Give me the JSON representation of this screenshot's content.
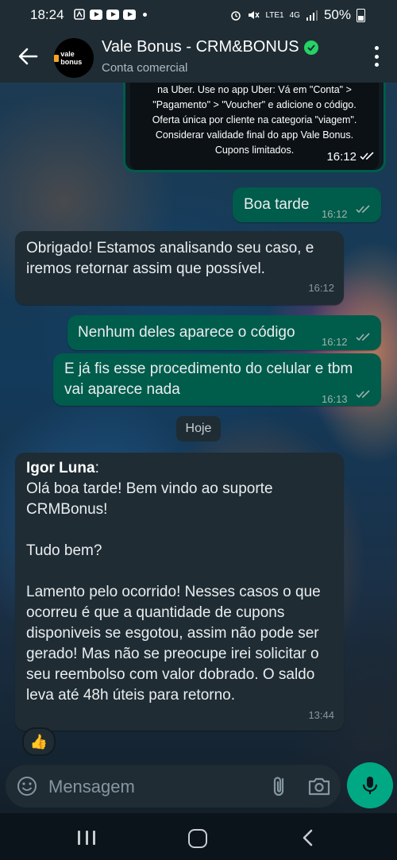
{
  "status_bar": {
    "time": "18:24",
    "battery": "50%",
    "network": "LTE1",
    "network_type": "4G"
  },
  "header": {
    "contact_name": "Vale Bonus - CRM&BONUS",
    "subtitle": "Conta comercial",
    "avatar_text": "vale bonus",
    "verified_color": "#25d366"
  },
  "messages": {
    "quoted": {
      "text": "na Uber. Use no app Uber: Vá em \"Conta\" > \"Pagamento\" > \"Voucher\" e adicione o código. Oferta única por cliente na categoria \"viagem\". Considerar validade final do app Vale Bonus. Cupons limitados.",
      "time": "16:12"
    },
    "m1": {
      "text": "Boa tarde",
      "time": "16:12",
      "direction": "out"
    },
    "m2": {
      "text": "Obrigado! Estamos analisando seu caso, e iremos retornar assim que possível.",
      "time": "16:12",
      "direction": "in"
    },
    "m3": {
      "text": "Nenhum deles aparece o código",
      "time": "16:12",
      "direction": "out"
    },
    "m4": {
      "text": "E já fis esse procedimento do celular e tbm vai aparece nada",
      "time": "16:13",
      "direction": "out"
    },
    "date_chip": "Hoje",
    "m5": {
      "sender": "Igor Luna",
      "line1": "Olá boa tarde! Bem vindo ao suporte CRMBonus!",
      "line2": "Tudo bem?",
      "line3": "Lamento pelo ocorrido! Nesses casos o que ocorreu é que a quantidade de cupons disponiveis se esgotou, assim não pode ser gerado! Mas não se preocupe irei solicitar o seu reembolso com valor dobrado. O saldo leva até 48h úteis para retorno.",
      "time": "13:44",
      "direction": "in",
      "reaction": "👍"
    }
  },
  "composer": {
    "placeholder": "Mensagem",
    "mic_color": "#00a884"
  },
  "colors": {
    "outgoing_bubble": "#005c4b",
    "incoming_bubble": "#1f2c34",
    "header_bg": "#1f2c34"
  }
}
